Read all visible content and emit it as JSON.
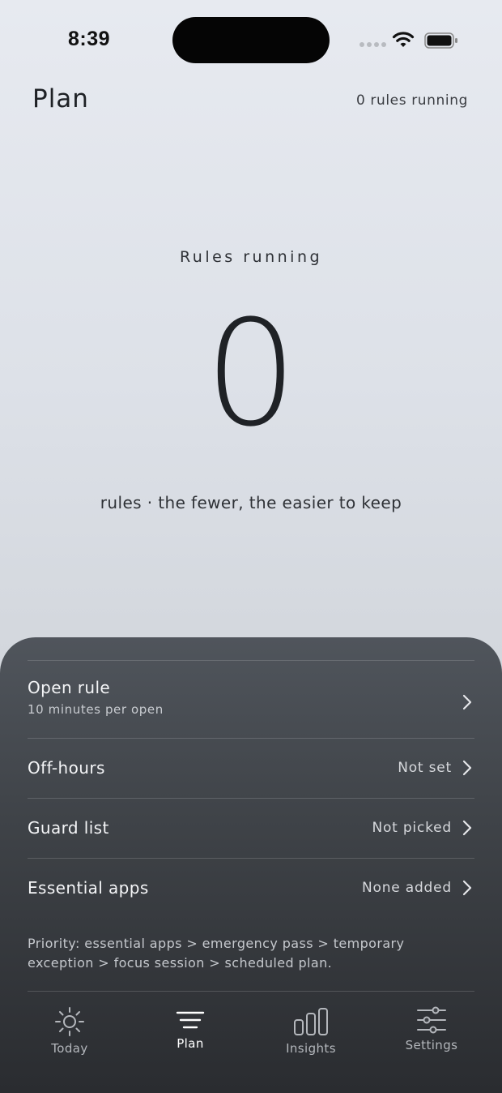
{
  "status_bar": {
    "time": "8:39"
  },
  "header": {
    "title": "Plan",
    "summary": "0 rules running"
  },
  "hero": {
    "label": "Rules running",
    "count": "0",
    "caption": "rules · the fewer, the easier to keep"
  },
  "rules": [
    {
      "title": "Open rule",
      "subtitle": "10 minutes per open",
      "value": ""
    },
    {
      "title": "Off-hours",
      "subtitle": "",
      "value": "Not set"
    },
    {
      "title": "Guard list",
      "subtitle": "",
      "value": "Not picked"
    },
    {
      "title": "Essential apps",
      "subtitle": "",
      "value": "None added"
    }
  ],
  "priority_note": "Priority: essential apps > emergency pass > temporary exception > focus session > scheduled plan.",
  "tabs": [
    {
      "label": "Today",
      "icon": "sun-icon",
      "active": false
    },
    {
      "label": "Plan",
      "icon": "lines-icon",
      "active": true
    },
    {
      "label": "Insights",
      "icon": "bar-chart-icon",
      "active": false
    },
    {
      "label": "Settings",
      "icon": "sliders-icon",
      "active": false
    }
  ]
}
